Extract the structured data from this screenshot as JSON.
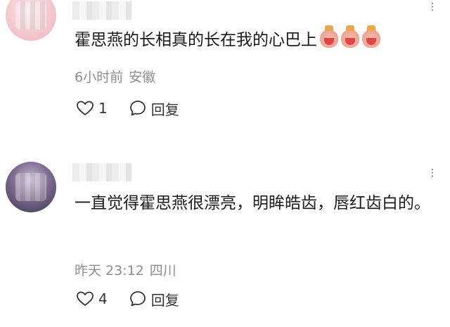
{
  "comments": [
    {
      "text": "霍思燕的长相真的长在我的心巴上",
      "emojis": [
        "smiling-face-emoji",
        "smiling-face-emoji",
        "smiling-face-emoji"
      ],
      "time": "6小时前",
      "location": "安徽",
      "likes": "1",
      "reply_label": "回复",
      "more_label": "⋮"
    },
    {
      "text": "一直觉得霍思燕很漂亮，明眸皓齿，唇红齿白的。",
      "time": "昨天 23:12",
      "location": "四川",
      "likes": "4",
      "reply_label": "回复",
      "more_label": "⋮"
    }
  ],
  "colors": {
    "text": "#1a1a1a",
    "meta": "#8e8e8e",
    "icon": "#333333"
  }
}
